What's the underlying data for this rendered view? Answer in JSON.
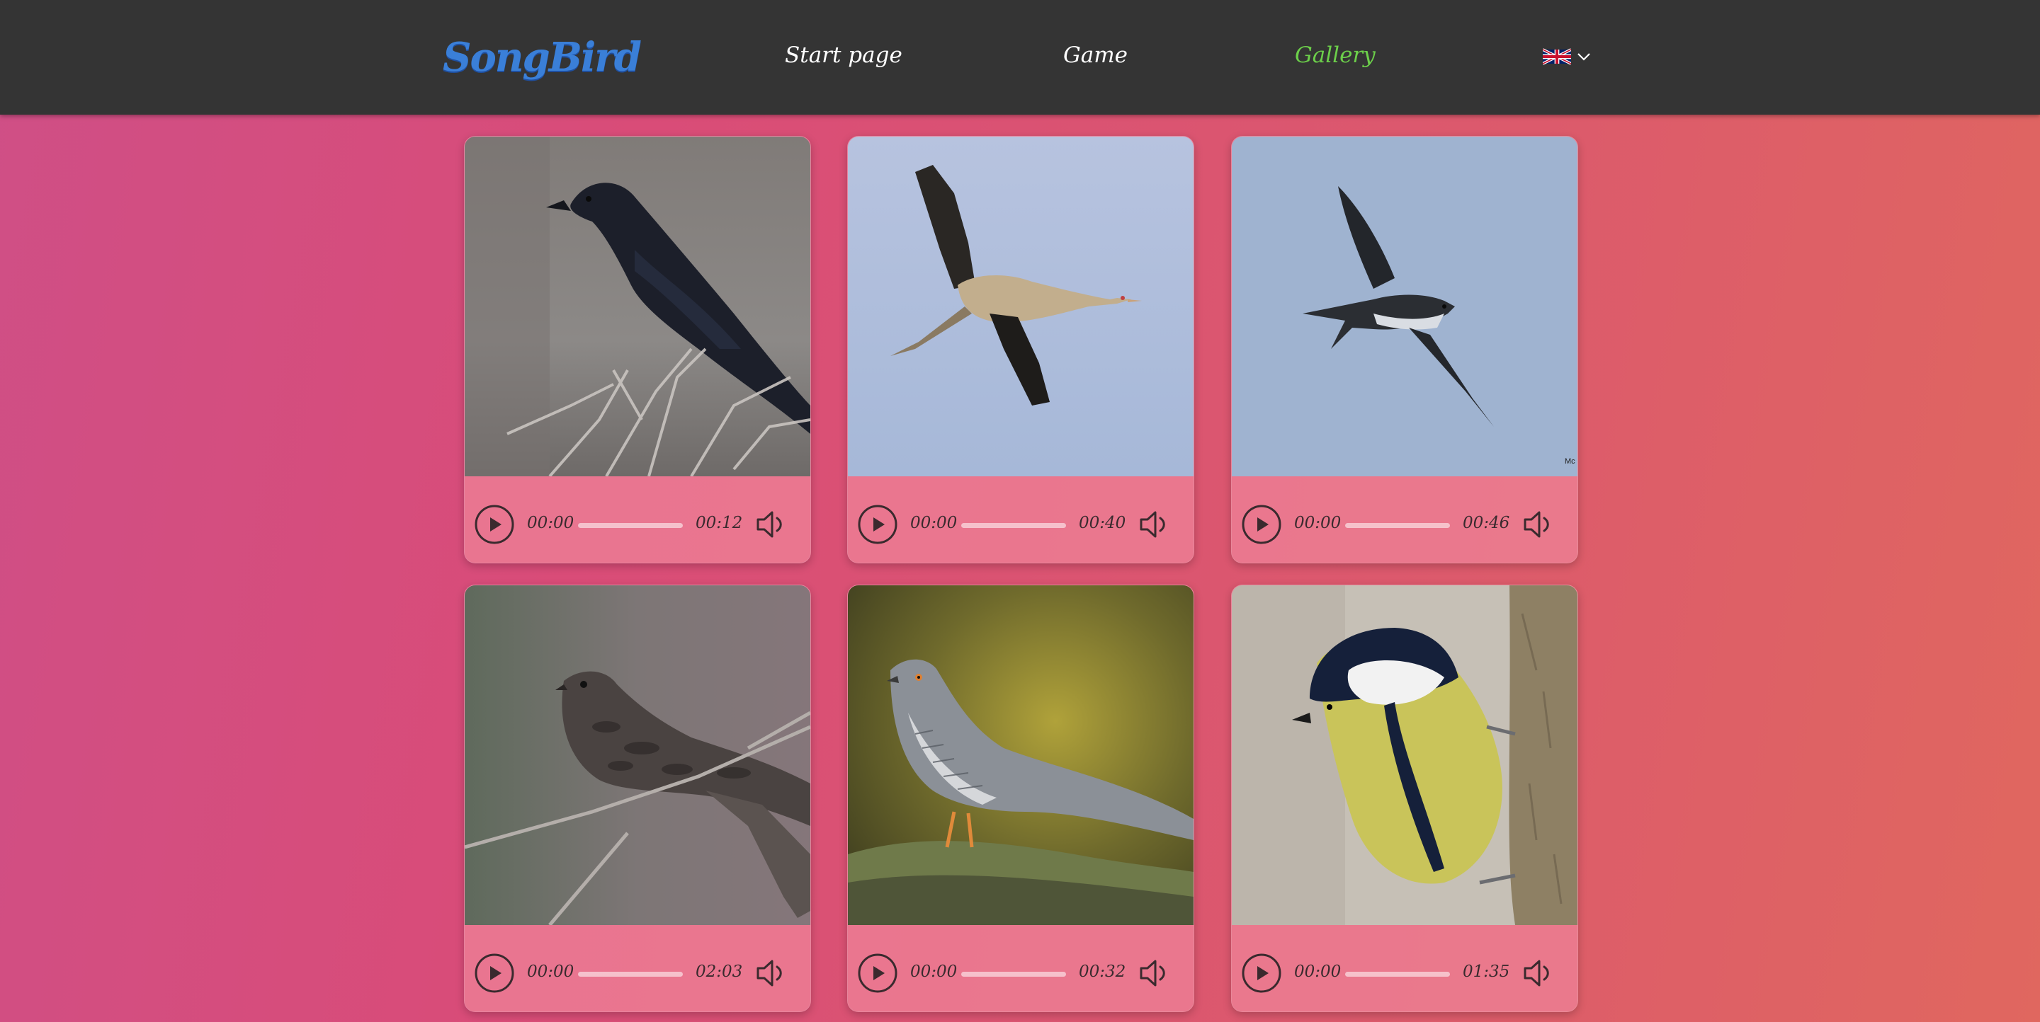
{
  "header": {
    "logo": "SongBird",
    "nav": [
      {
        "label": "Start page",
        "active": false
      },
      {
        "label": "Game",
        "active": false
      },
      {
        "label": "Gallery",
        "active": true
      }
    ],
    "language": {
      "flag": "uk-flag-icon",
      "menu_icon": "chevron-down-icon"
    }
  },
  "colors": {
    "header_bg": "#343434",
    "logo": "#3a7fd8",
    "nav_text": "#ffffff",
    "nav_active": "#6ccf4a",
    "page_gradient": [
      "#cf4f86",
      "#e0675f"
    ]
  },
  "gallery": {
    "cards": [
      {
        "image": "raven-photo",
        "current_time": "00:00",
        "duration": "00:12",
        "progress": 0
      },
      {
        "image": "crane-photo",
        "current_time": "00:00",
        "duration": "00:40",
        "progress": 0
      },
      {
        "image": "swallow-photo",
        "current_time": "00:00",
        "duration": "00:46",
        "progress": 0,
        "watermark": "Mc"
      },
      {
        "image": "nightjar-photo",
        "current_time": "00:00",
        "duration": "02:03",
        "progress": 0
      },
      {
        "image": "cuckoo-photo",
        "current_time": "00:00",
        "duration": "00:32",
        "progress": 0
      },
      {
        "image": "great-tit-photo",
        "current_time": "00:00",
        "duration": "01:35",
        "progress": 0
      }
    ]
  }
}
